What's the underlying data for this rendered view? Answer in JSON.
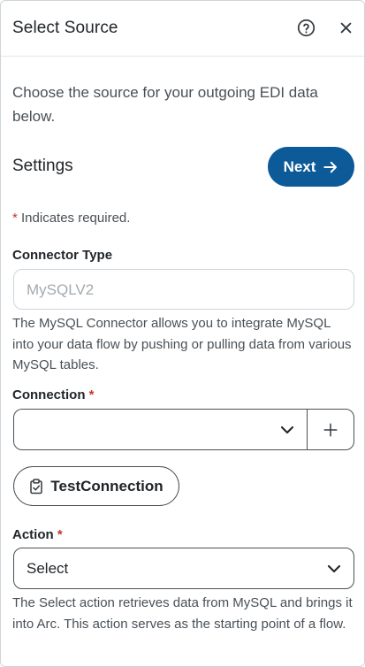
{
  "header": {
    "title": "Select Source",
    "help_icon": "question-circle-icon",
    "close_icon": "close-icon"
  },
  "intro": "Choose the source for your outgoing EDI data below.",
  "settings": {
    "title": "Settings",
    "next_label": "Next"
  },
  "required_note": {
    "star": "*",
    "text": " Indicates required."
  },
  "connector_type": {
    "label": "Connector Type",
    "value": "MySQLV2",
    "help": "The MySQL Connector allows you to integrate MySQL into your data flow by pushing or pulling data from various MySQL tables."
  },
  "connection": {
    "label": "Connection",
    "required_star": "*",
    "value": "",
    "add_icon": "plus-icon"
  },
  "test_connection": {
    "label": "TestConnection",
    "icon": "clipboard-check-icon"
  },
  "action": {
    "label": "Action",
    "required_star": "*",
    "value": "Select",
    "help": "The Select action retrieves data from MySQL and brings it into Arc. This action serves as the starting point of a flow."
  },
  "colors": {
    "primary": "#0d5a98",
    "required": "#c0392b",
    "text": "#212529",
    "muted": "#495057"
  }
}
